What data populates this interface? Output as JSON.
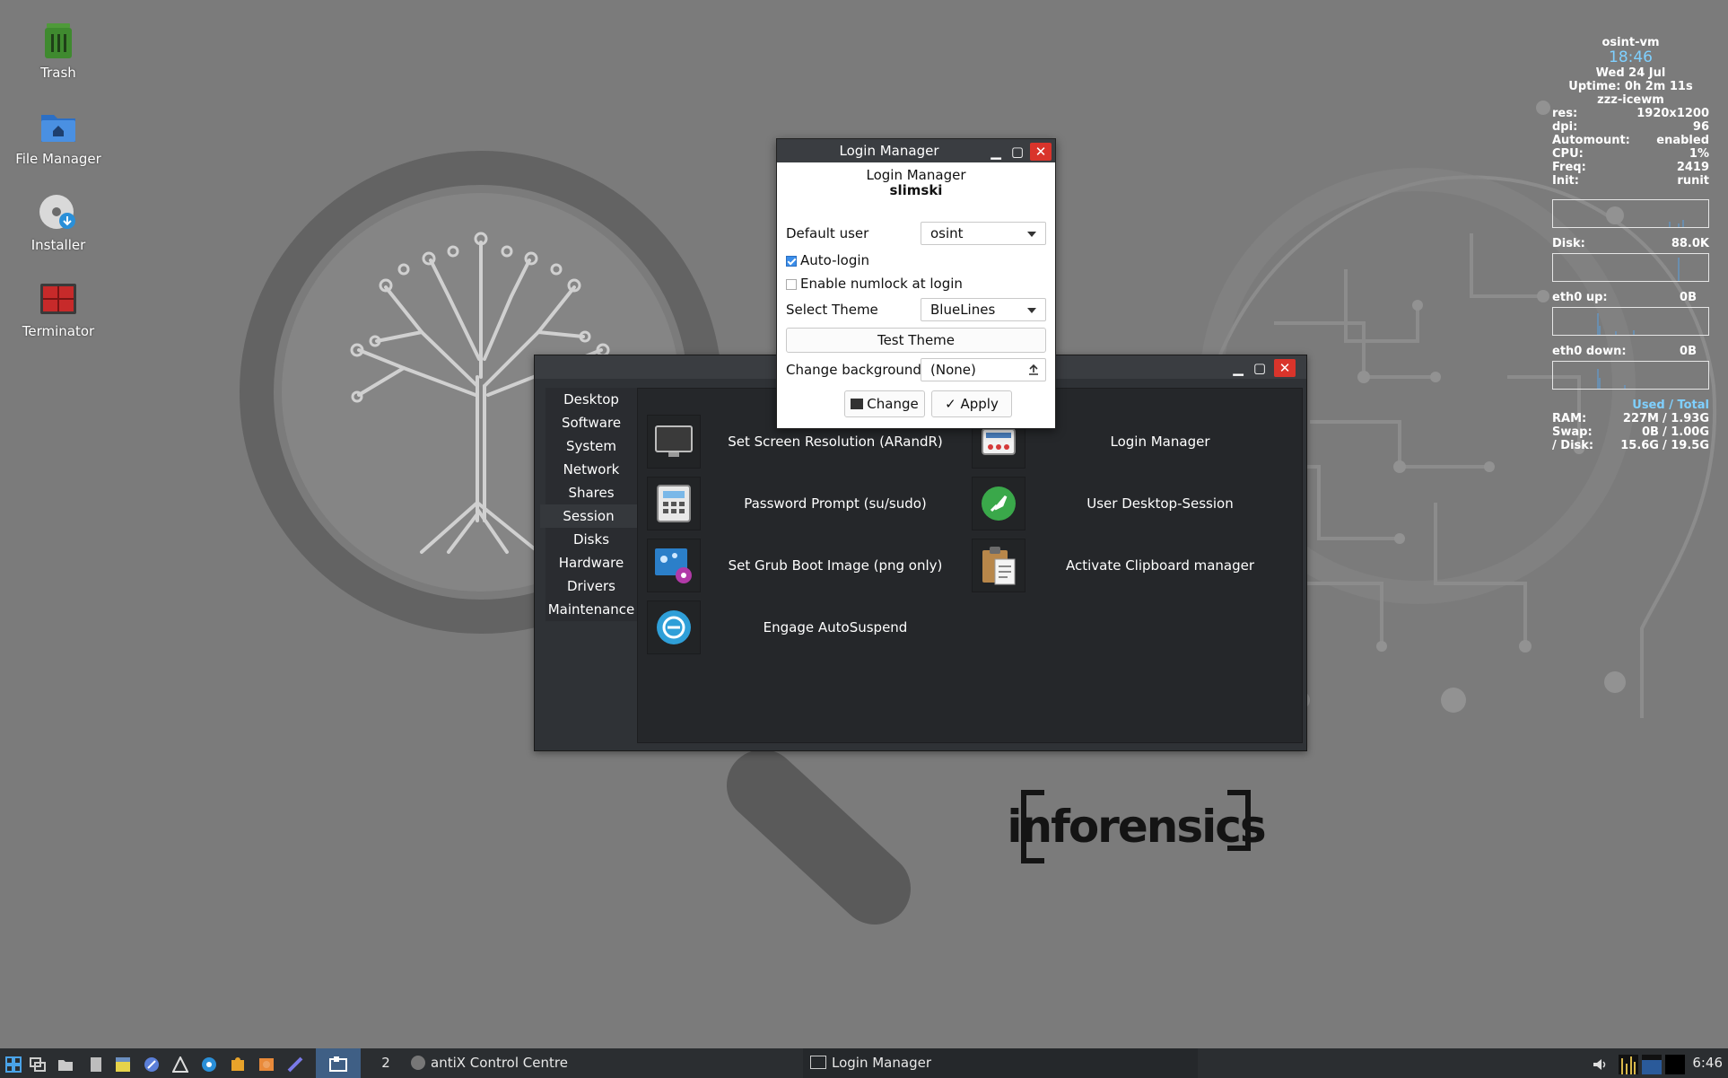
{
  "desktop_icons": [
    {
      "label": "Trash",
      "icon": "trash-icon"
    },
    {
      "label": "File Manager",
      "icon": "folder-home-icon"
    },
    {
      "label": "Installer",
      "icon": "installer-disc-icon"
    },
    {
      "label": "Terminator",
      "icon": "terminal-icon"
    }
  ],
  "wallpaper": {
    "brand": "inforensics"
  },
  "conky": {
    "host": "osint-vm",
    "time": "18:46",
    "date": "Wed 24 Jul",
    "uptime": "Uptime: 0h 2m 11s",
    "wm": "zzz-icewm",
    "stats": [
      {
        "k": "res:",
        "v": "1920x1200"
      },
      {
        "k": "dpi:",
        "v": "96"
      },
      {
        "k": "Automount:",
        "v": "enabled"
      },
      {
        "k": "CPU:",
        "v": "1%"
      },
      {
        "k": "Freq:",
        "v": "2419"
      },
      {
        "k": "Init:",
        "v": "runit"
      }
    ],
    "disk": {
      "k": "Disk:",
      "v": "88.0K"
    },
    "eth_up": {
      "k": "eth0 up:",
      "v": "0B"
    },
    "eth_down": {
      "k": "eth0 down:",
      "v": "0B"
    },
    "mem_header": "Used / Total",
    "mem": [
      {
        "k": "RAM:",
        "used": "227M",
        "total": "1.93G"
      },
      {
        "k": "Swap:",
        "used": "0B",
        "total": "1.00G"
      },
      {
        "k": "/ Disk:",
        "used": "15.6G",
        "total": "19.5G"
      }
    ]
  },
  "control_centre": {
    "sidebar": [
      "Desktop",
      "Software",
      "System",
      "Network",
      "Shares",
      "Session",
      "Disks",
      "Hardware",
      "Drivers",
      "Maintenance"
    ],
    "active": "Session",
    "items": [
      {
        "label": "Set Screen Resolution (ARandR)",
        "icon": "monitor-icon"
      },
      {
        "label": "Login Manager",
        "icon": "login-manager-icon"
      },
      {
        "label": "Password Prompt (su/sudo)",
        "icon": "password-keypad-icon"
      },
      {
        "label": "User Desktop-Session",
        "icon": "rocket-icon"
      },
      {
        "label": "Set Grub Boot Image (png only)",
        "icon": "grub-image-icon"
      },
      {
        "label": "Activate Clipboard manager",
        "icon": "clipboard-icon"
      },
      {
        "label": "Engage AutoSuspend",
        "icon": "suspend-icon"
      }
    ],
    "colors": {
      "window_bg": "#2f3236",
      "content_bg": "#25272a"
    }
  },
  "login_manager": {
    "title": "Login Manager",
    "heading": "Login Manager",
    "subheading": "slimski",
    "default_user_label": "Default user",
    "default_user_value": "osint",
    "autologin_label": "Auto-login",
    "autologin_checked": true,
    "numlock_label": "Enable numlock at login",
    "numlock_checked": false,
    "theme_label": "Select Theme",
    "theme_value": "BlueLines",
    "test_theme_label": "Test Theme",
    "background_label": "Change background",
    "background_value": "(None)",
    "change_label": "Change",
    "apply_label": "Apply",
    "colors": {
      "close": "#d9342b",
      "check": "#3b8eea"
    }
  },
  "taskbar": {
    "workspace": "2",
    "tasks": [
      {
        "label": "antiX Control Centre",
        "icon": "control-centre-icon"
      },
      {
        "label": "Login Manager",
        "icon": "window-icon"
      }
    ],
    "clock": "6:46"
  }
}
